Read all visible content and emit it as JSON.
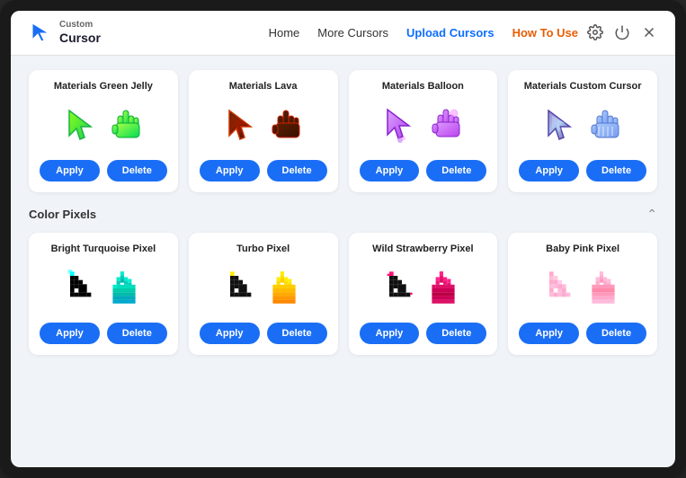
{
  "app": {
    "title": "Custom Cursor"
  },
  "header": {
    "logo_line1": "Custom",
    "logo_line2": "Cursor",
    "nav_items": [
      {
        "label": "Home",
        "class": "normal"
      },
      {
        "label": "More Cursors",
        "class": "normal"
      },
      {
        "label": "Upload Cursors",
        "class": "highlight"
      },
      {
        "label": "How To Use",
        "class": "active"
      }
    ]
  },
  "sections": [
    {
      "id": "materials",
      "title": "",
      "collapsible": false,
      "cards": [
        {
          "id": "green-jelly",
          "title": "Materials Green Jelly",
          "cursor_type": "green-jelly",
          "apply_label": "Apply",
          "delete_label": "Delete"
        },
        {
          "id": "lava",
          "title": "Materials Lava",
          "cursor_type": "lava",
          "apply_label": "Apply",
          "delete_label": "Delete"
        },
        {
          "id": "balloon",
          "title": "Materials Balloon",
          "cursor_type": "balloon",
          "apply_label": "Apply",
          "delete_label": "Delete"
        },
        {
          "id": "custom-cursor",
          "title": "Materials Custom Cursor",
          "cursor_type": "custom-cursor",
          "apply_label": "Apply",
          "delete_label": "Delete"
        }
      ]
    },
    {
      "id": "color-pixels",
      "title": "Color Pixels",
      "collapsible": true,
      "cards": [
        {
          "id": "bright-turquoise",
          "title": "Bright Turquoise Pixel",
          "cursor_type": "bright-turquoise",
          "apply_label": "Apply",
          "delete_label": "Delete"
        },
        {
          "id": "turbo",
          "title": "Turbo Pixel",
          "cursor_type": "turbo",
          "apply_label": "Apply",
          "delete_label": "Delete"
        },
        {
          "id": "wild-strawberry",
          "title": "Wild Strawberry Pixel",
          "cursor_type": "wild-strawberry",
          "apply_label": "Apply",
          "delete_label": "Delete"
        },
        {
          "id": "baby-pink",
          "title": "Baby Pink Pixel",
          "cursor_type": "baby-pink",
          "apply_label": "Apply",
          "delete_label": "Delete"
        }
      ]
    }
  ]
}
